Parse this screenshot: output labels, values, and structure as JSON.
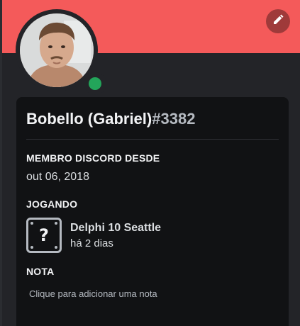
{
  "profile": {
    "display_name": "Bobello (Gabriel)",
    "discriminator": "#3382",
    "banner_color": "#f45a5a",
    "status": "online",
    "status_color": "#23a55a",
    "avatar_icon": "user-avatar"
  },
  "header": {
    "edit_icon": "pencil-icon"
  },
  "member_since": {
    "title": "MEMBRO DISCORD DESDE",
    "date": "out 06, 2018"
  },
  "activity": {
    "title": "JOGANDO",
    "game_name": "Delphi 10 Seattle",
    "elapsed": "há 2 dias",
    "icon": "unknown-game-icon"
  },
  "note": {
    "title": "NOTA",
    "placeholder": "Clique para adicionar uma nota"
  }
}
